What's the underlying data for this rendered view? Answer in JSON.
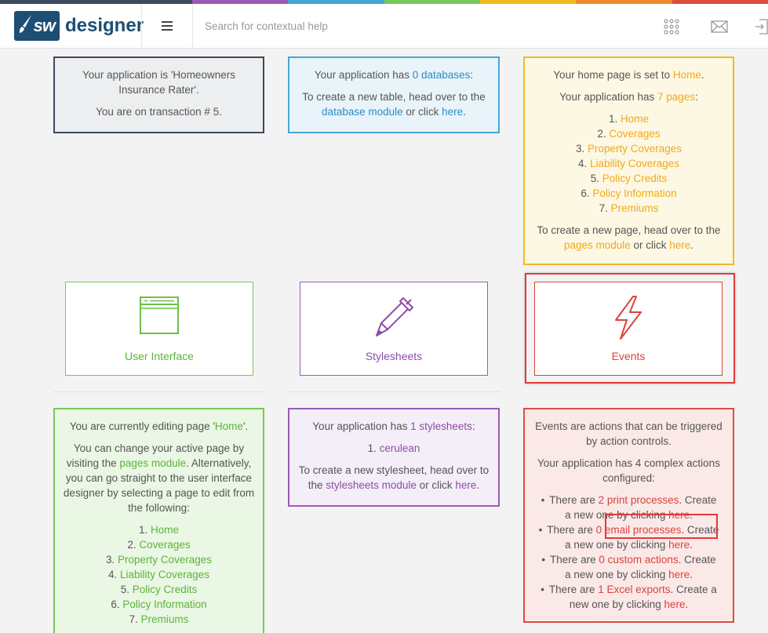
{
  "colors": {
    "navy": "#1d4e73",
    "accent_blue": "#46a6d6",
    "accent_yellow": "#f2b922",
    "accent_green": "#78c75a",
    "accent_purple": "#9a5bb3",
    "accent_red": "#de4b41"
  },
  "header": {
    "logo_mark": "sw",
    "logo_text": "designer",
    "search_placeholder": "Search for contextual help",
    "icons": [
      "menu-icon",
      "apps-grid-icon",
      "mail-icon",
      "logout-icon"
    ]
  },
  "app_panel": {
    "line1": "Your application is 'Homeowners Insurance Rater'.",
    "line2": "You are on transaction # 5."
  },
  "db_panel": {
    "prefix": "Your application has ",
    "count_link": "0 databases",
    "suffix": ":",
    "cta_prefix": "To create a new table, head over to the ",
    "module_link": "database module",
    "cta_mid": " or click ",
    "here_link": "here",
    "cta_end": "."
  },
  "pages_panel": {
    "home_prefix": "Your home page is set to ",
    "home_link": "Home",
    "home_end": ".",
    "count_prefix": "Your application has ",
    "count_link": "7 pages",
    "count_end": ":",
    "pages": [
      "Home",
      "Coverages",
      "Property Coverages",
      "Liability Coverages",
      "Policy Credits",
      "Policy Information",
      "Premiums"
    ],
    "cta_prefix": "To create a new page, head over to the ",
    "module_link": "pages module",
    "cta_mid": " or click ",
    "here_link": "here",
    "cta_end": "."
  },
  "tiles": {
    "ui": "User Interface",
    "stylesheets": "Stylesheets",
    "events": "Events"
  },
  "editing_panel": {
    "p1_prefix": "You are currently editing page '",
    "p1_link": "Home",
    "p1_end": "'.",
    "p2_a": "You can change your active page by visiting the ",
    "p2_link": "pages module",
    "p2_b": ". Alternatively, you can go straight to the user interface designer by selecting a page to edit from the following:",
    "pages": [
      "Home",
      "Coverages",
      "Property Coverages",
      "Liability Coverages",
      "Policy Credits",
      "Policy Information",
      "Premiums"
    ]
  },
  "stylesheet_panel": {
    "prefix": "Your application has ",
    "count_link": "1 stylesheets",
    "suffix": ":",
    "sheets": [
      "cerulean"
    ],
    "cta_prefix": "To create a new stylesheet, head over to the ",
    "module_link": "stylesheets module",
    "cta_mid": " or click ",
    "here_link": "here",
    "cta_end": "."
  },
  "events_panel": {
    "intro": "Events are actions that can be triggered by action controls.",
    "complex": "Your application has 4 complex actions configured:",
    "there_are": "There are ",
    "create_text": " Create a new one by clicking ",
    "here_link": "here",
    "items": [
      {
        "link": "2 print processes",
        "end": "."
      },
      {
        "link": "0 email processes",
        "end": "."
      },
      {
        "link": "0 custom actions",
        "end": "."
      },
      {
        "link": "1 Excel exports",
        "end": "."
      }
    ]
  }
}
